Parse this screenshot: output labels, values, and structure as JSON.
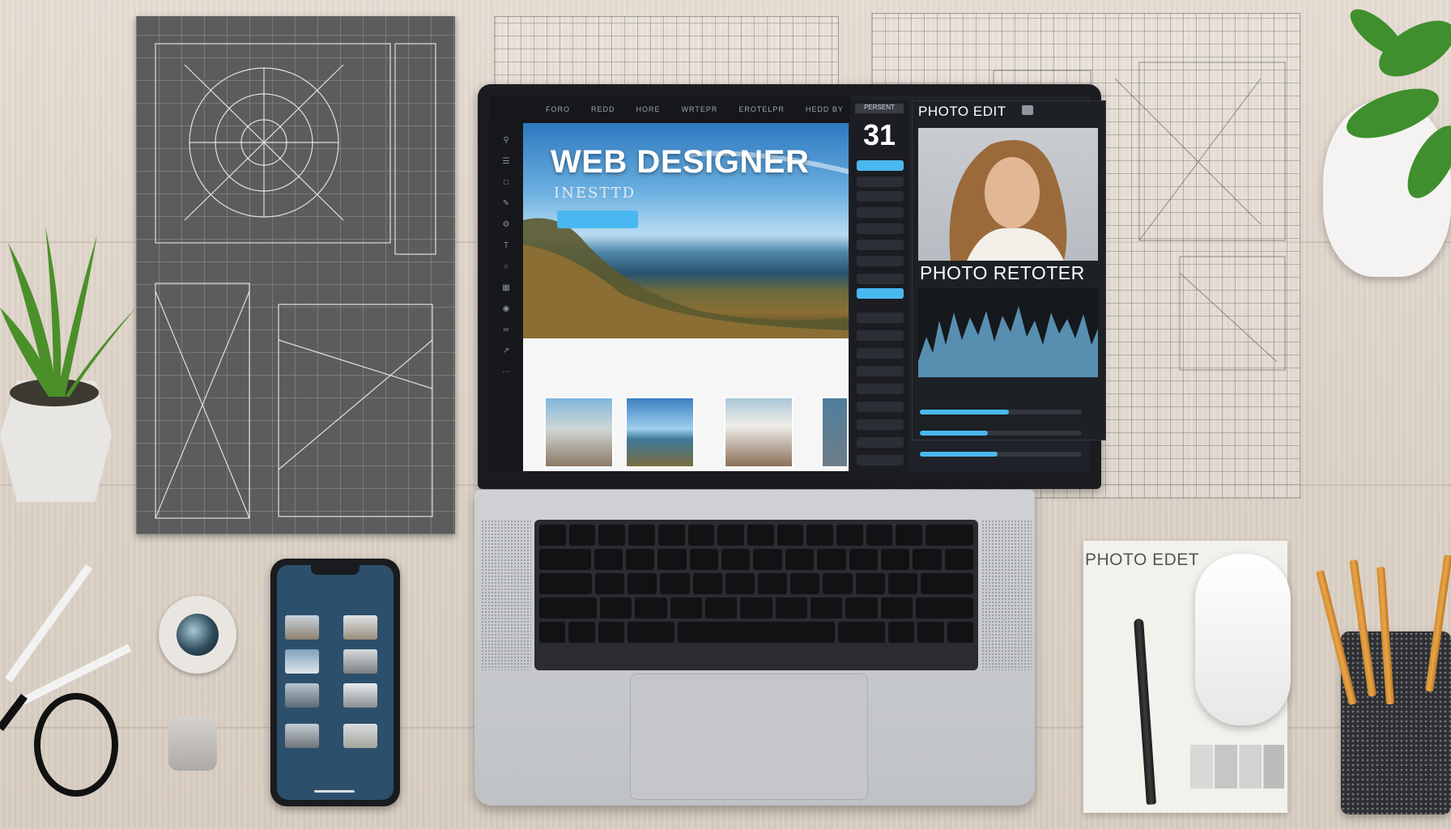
{
  "web_designer": {
    "hero_title": "WEB DESIGNER",
    "hero_subtitle": "INESTTD",
    "nav_items": [
      "FORO",
      "REDD",
      "HORE",
      "WRTEPR",
      "EROTELPR",
      "HEDD BY"
    ]
  },
  "tool_panel": {
    "header": "PERSENT",
    "date": "31"
  },
  "photo_editor": {
    "title": "PHOTO EDIT",
    "retoucher_title": "PHOTO RETOTER"
  },
  "notepad": {
    "label": "PHOTO EDET"
  },
  "colors": {
    "accent": "#4ab8f0",
    "desk": "#ddd3c8",
    "screen_bg": "#1f2228"
  },
  "icons": [
    "search-icon",
    "layers-icon",
    "crop-icon",
    "brush-icon",
    "settings-icon"
  ]
}
